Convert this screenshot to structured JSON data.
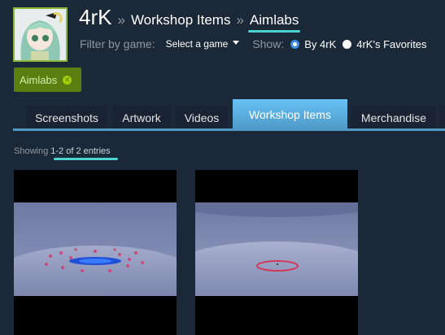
{
  "header": {
    "user_name": "4rK",
    "separator": "»",
    "section": "Workshop Items",
    "current": "Aimlabs"
  },
  "filter": {
    "label": "Filter by game:",
    "select_value": "Select a game",
    "show_label": "Show:",
    "options": [
      "By 4rK",
      "4rK's Favorites"
    ],
    "selected": "By 4rK"
  },
  "tag": {
    "label": "Aimlabs",
    "remove_icon": "close-icon"
  },
  "tabs": [
    "Screenshots",
    "Artwork",
    "Videos",
    "Workshop Items",
    "Merchandise"
  ],
  "active_tab": "Workshop Items",
  "listing": {
    "showing_prefix": "Showing",
    "showing_range": "1-2 of 2 entries"
  },
  "items": [
    {
      "thumbnail": "aimlabs-arena-blue-target"
    },
    {
      "thumbnail": "aimlabs-arena-red-ring"
    }
  ],
  "colors": {
    "background": "#1b2838",
    "tab_active": "#67c1f5",
    "tag_bg": "#5c7e10",
    "annotation_underline": "#4fd2d2"
  }
}
